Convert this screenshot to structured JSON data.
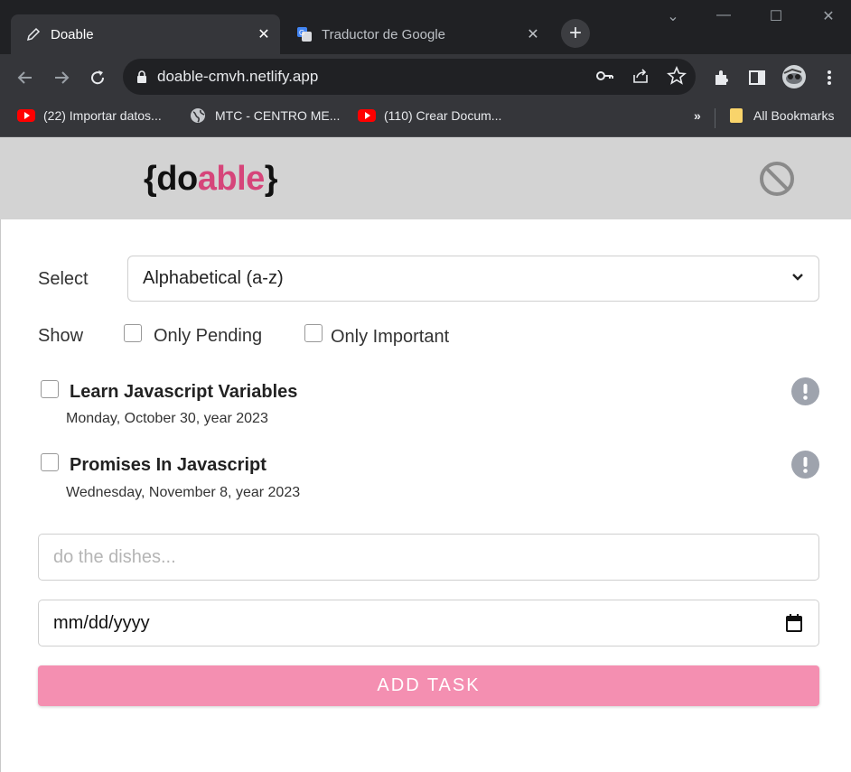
{
  "browser": {
    "tabs": [
      {
        "title": "Doable",
        "active": true
      },
      {
        "title": "Traductor de Google",
        "active": false
      }
    ],
    "url": "doable-cmvh.netlify.app",
    "bookmarks": [
      {
        "label": "(22) Importar datos...",
        "icon": "youtube-icon"
      },
      {
        "label": "MTC - CENTRO ME...",
        "icon": "globe-icon"
      },
      {
        "label": "(110) Crear Docum...",
        "icon": "youtube-icon"
      }
    ],
    "bookmarks_overflow": "»",
    "all_bookmarks": "All Bookmarks"
  },
  "header": {
    "logo_open": "{do",
    "logo_accent": "able",
    "logo_close": "}",
    "accent_color": "#d6457a"
  },
  "controls": {
    "select_label": "Select",
    "select_value": "Alphabetical (a-z)",
    "show_label": "Show",
    "filter_pending": "Only Pending",
    "filter_important": "Only Important"
  },
  "tasks": [
    {
      "title": "Learn Javascript Variables",
      "date": "Monday, October 30, year 2023",
      "done": false
    },
    {
      "title": "Promises In Javascript",
      "date": "Wednesday, November 8, year 2023",
      "done": false
    }
  ],
  "form": {
    "task_placeholder": "do the dishes...",
    "date_placeholder": "mm/dd/yyyy",
    "add_label": "ADD TASK",
    "button_color": "#f48fb1"
  }
}
